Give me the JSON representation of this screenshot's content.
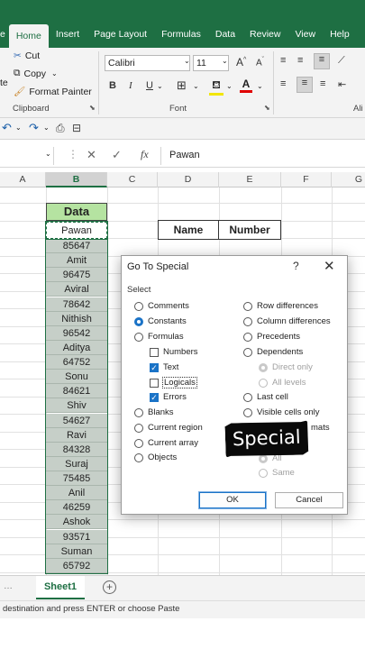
{
  "ribbon": {
    "tabs": [
      "e",
      "Home",
      "Insert",
      "Page Layout",
      "Formulas",
      "Data",
      "Review",
      "View",
      "Help"
    ],
    "active_tab": "Home",
    "clipboard": {
      "cut": "Cut",
      "copy": "Copy",
      "format_painter": "Format Painter",
      "paste_fragment": "te",
      "label": "Clipboard"
    },
    "font": {
      "name": "Calibri",
      "size": "11",
      "label": "Font",
      "bold": "B",
      "italic": "I",
      "underline": "U",
      "grow": "A",
      "shrink": "A"
    },
    "alignment_label_fragment": "Ali"
  },
  "formula_bar": {
    "fx": "fx",
    "value": "Pawan"
  },
  "columns": [
    "A",
    "B",
    "C",
    "D",
    "E",
    "F",
    "G"
  ],
  "selected_column": "B",
  "data_header": "Data",
  "active_cell": "Pawan",
  "data_column": [
    "85647",
    "Amit",
    "96475",
    "Aviral",
    "78642",
    "Nithish",
    "96542",
    "Aditya",
    "64752",
    "Sonu",
    "84621",
    "Shiv",
    "54627",
    "Ravi",
    "84328",
    "Suraj",
    "75485",
    "Anil",
    "46259",
    "Ashok",
    "93571",
    "Suman",
    "65792"
  ],
  "table_headers": {
    "name": "Name",
    "number": "Number"
  },
  "sheet": {
    "tab": "Sheet1",
    "add": "+"
  },
  "status": "destination and press ENTER or choose Paste",
  "dialog": {
    "title": "Go To Special",
    "help": "?",
    "close": "✕",
    "select_label": "Select",
    "left_options": {
      "comments": "Comments",
      "constants": "Constants",
      "formulas": "Formulas",
      "numbers": "Numbers",
      "text": "Text",
      "logicals": "Logicals",
      "errors": "Errors",
      "blanks": "Blanks",
      "current_region": "Current region",
      "current_array": "Current array",
      "objects": "Objects"
    },
    "right_options": {
      "row_differences": "Row differences",
      "column_differences": "Column differences",
      "precedents": "Precedents",
      "dependents": "Dependents",
      "direct_only": "Direct only",
      "all_levels": "All levels",
      "last_cell": "Last cell",
      "visible_cells_only": "Visible cells only",
      "formats_fragment": "mats",
      "all": "All",
      "same": "Same"
    },
    "ok": "OK",
    "cancel": "Cancel"
  },
  "overlay_caption": "Special",
  "colors": {
    "accent": "#1e6f43",
    "selection": "#1a73c7",
    "data_header_bg": "#b5e3a1"
  }
}
